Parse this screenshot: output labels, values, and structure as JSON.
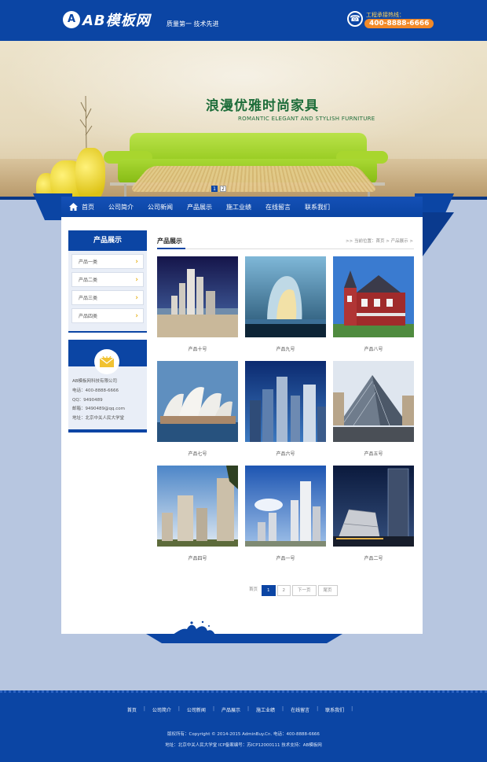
{
  "header": {
    "logo_badge": "A",
    "logo_text": "AB模板网",
    "slogan": "质量第一  技术先进",
    "hotline_label": "工程承接热线：",
    "hotline_number": "400-8888-6666"
  },
  "banner": {
    "title": "浪漫优雅时尚家具",
    "subtitle": "ROMANTIC ELEGANT AND STYLISH FURNITURE",
    "dots": [
      "1",
      "2"
    ],
    "active_dot": 1
  },
  "nav": {
    "items": [
      "首页",
      "公司简介",
      "公司新闻",
      "产品展示",
      "施工业绩",
      "在线留言",
      "联系我们"
    ]
  },
  "sidebar": {
    "title": "产品展示",
    "items": [
      "产品一类",
      "产品二类",
      "产品三类",
      "产品四类"
    ],
    "contact": [
      "AB模板网科技有限公司",
      "电话：400-8888-6666",
      "QQ：9490489",
      "邮箱：9490489@qq.com",
      "地址：北京中关人民大学堂"
    ]
  },
  "products": {
    "title": "产品展示",
    "breadcrumb": ">> 当前位置：首页 > 产品展示 >",
    "items": [
      "产品十号",
      "产品九号",
      "产品八号",
      "产品七号",
      "产品六号",
      "产品五号",
      "产品四号",
      "产品一号",
      "产品二号"
    ]
  },
  "pagination": {
    "first": "首页",
    "pages": [
      "1",
      "2"
    ],
    "current": "1",
    "next": "下一页",
    "last": "尾页"
  },
  "footer": {
    "nav": [
      "首页",
      "公司简介",
      "公司新闻",
      "产品展示",
      "施工业绩",
      "在线留言",
      "联系我们"
    ],
    "copyright": "版权所有：Copyright © 2014-2015 AdminBuy.Cn.   电话：400-8888-6666",
    "address": "地址：北京中关人民大学堂   ICP备案编号：苏ICP12000111   技术支持：AB模板网"
  },
  "colors": {
    "brand_blue": "#0b45a4",
    "page_bg": "#b7c6e0",
    "hotline_orange": "#f28a28",
    "banner_title_green": "#1e6d3a"
  }
}
